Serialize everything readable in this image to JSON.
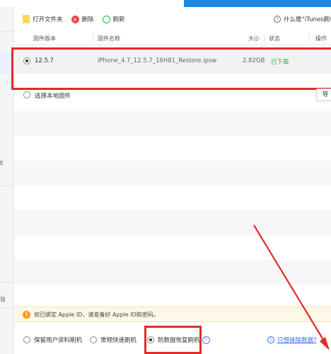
{
  "toolbar": {
    "open_folder": "打开文件夹",
    "delete": "删除",
    "refresh": "刷新",
    "help_text": "什么是“iTunes刷机”"
  },
  "table": {
    "headers": [
      "固件版本",
      "固件名称",
      "大小",
      "状态",
      "操作"
    ],
    "rows": [
      {
        "version": "12.5.7",
        "name": "iPhone_4.7_12.5.7_16H81_Restore.ipsw",
        "size": "2.82GB",
        "status": "已下载"
      }
    ],
    "local_firmware": "选择本地固件",
    "import_button": "导"
  },
  "sidebar": {
    "glyph_a": "E",
    "glyph_b": "导"
  },
  "notice": {
    "text": "如已绑定 Apple ID，请准备好 Apple ID和密码。"
  },
  "modes": {
    "opt1": "保留用户资料刷机",
    "opt2": "常规快速刷机",
    "opt3": "防数据恢复刷机",
    "opt3_help": "?",
    "erase_link": "只想抹除数据?"
  },
  "colors": {
    "accent": "#1e88e5",
    "highlight": "#e22b2b",
    "success": "#22b34a",
    "warning": "#f4a100"
  }
}
